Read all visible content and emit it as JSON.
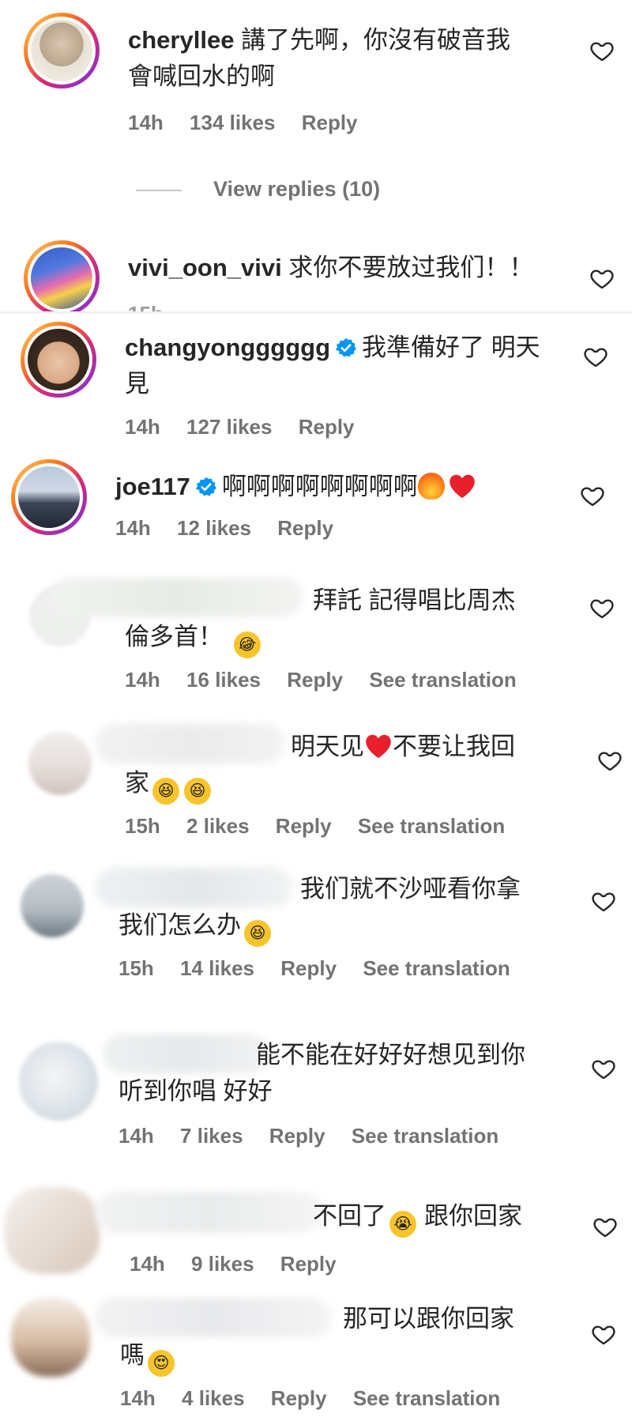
{
  "comments": [
    {
      "username": "cheryllee",
      "text": "講了先啊，你沒有破音我\n會喊回水的啊",
      "time": "14h",
      "likes": "134 likes",
      "reply": "Reply"
    },
    {
      "view_replies": "View replies (10)"
    },
    {
      "username": "vivi_oon_vivi",
      "text": "求你不要放过我们！！"
    },
    {
      "username": "changyongggggg",
      "text_line1": "我準備好了 明天",
      "text_line2": "見",
      "time": "14h",
      "likes": "127 likes",
      "reply": "Reply"
    },
    {
      "username": "joe117",
      "text": "啊啊啊啊啊啊啊啊",
      "time": "14h",
      "likes": "12 likes",
      "reply": "Reply"
    },
    {
      "text_line1": "拜託 記得唱比周杰",
      "text_line2": "倫多首！",
      "time": "14h",
      "likes": "16 likes",
      "reply": "Reply",
      "see_translation": "See translation"
    },
    {
      "text_line1": "明天见",
      "text_line1b": "不要让我回",
      "text_line2": "家",
      "time": "15h",
      "likes": "2 likes",
      "reply": "Reply",
      "see_translation": "See translation"
    },
    {
      "text_line1": "我们就不沙哑看你拿",
      "text_line2": "我们怎么办",
      "time": "15h",
      "likes": "14 likes",
      "reply": "Reply",
      "see_translation": "See translation"
    },
    {
      "text_line1": "能不能在好好好想见到你",
      "text_line2": "听到你唱 好好",
      "time": "14h",
      "likes": "7 likes",
      "reply": "Reply",
      "see_translation": "See translation"
    },
    {
      "text_line1": "不回了",
      "text_line1b": "跟你回家",
      "time": "14h",
      "likes": "9 likes",
      "reply": "Reply"
    },
    {
      "text_line1": "那可以跟你回家",
      "text_line2": "嗎",
      "time": "14h",
      "likes": "4 likes",
      "reply": "Reply",
      "see_translation": "See translation"
    }
  ],
  "icons": {
    "heart": "heart-outline-icon",
    "verified": "verified-badge-icon"
  },
  "colors": {
    "verified_blue": "#0095f6",
    "meta_gray": "#737373",
    "text": "#262626",
    "story_ring_start": "#feda75",
    "story_ring_end": "#962fbf"
  }
}
